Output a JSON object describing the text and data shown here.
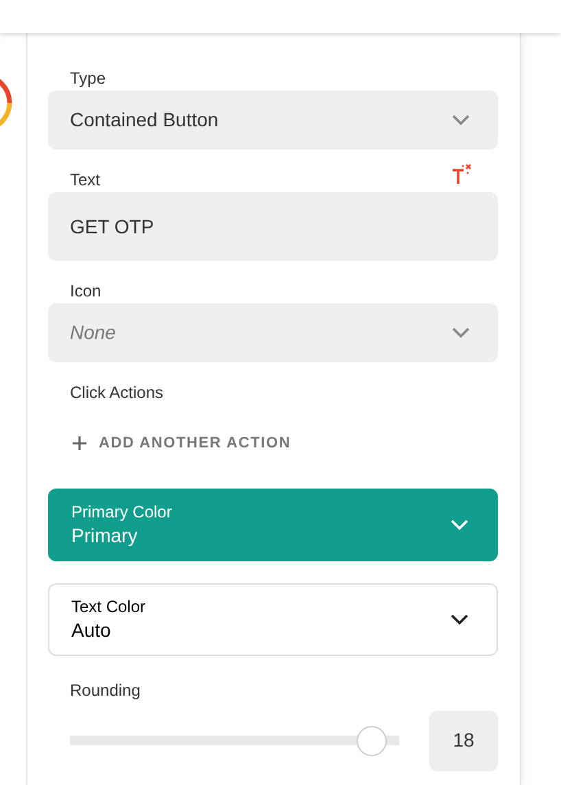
{
  "fields": [
    {
      "kind": "select",
      "label": "Type",
      "value": "Contained Button"
    },
    {
      "kind": "text",
      "label": "Text",
      "value": "GET OTP"
    },
    {
      "kind": "select",
      "label": "Icon",
      "placeholder": "None"
    }
  ],
  "click_actions": {
    "label": "Click Actions",
    "add_button": "ADD ANOTHER ACTION"
  },
  "color_selects": [
    {
      "label": "Primary Color",
      "value": "Primary",
      "color": "#129e8d"
    },
    {
      "label": "Text Color",
      "value": "Auto"
    }
  ],
  "rounding": {
    "label": "Rounding",
    "level": 0.96,
    "value": "18"
  }
}
